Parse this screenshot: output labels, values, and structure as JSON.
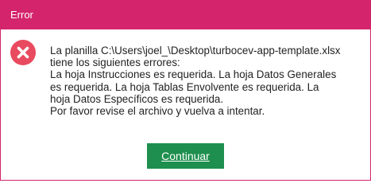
{
  "dialog": {
    "title": "Error",
    "icon": "error-x-circle-icon",
    "message_lines": [
      "La planilla C:\\Users\\joel_\\Desktop\\turbocev-app-template.xlsx",
      "tiene los siguientes errores:",
      "La hoja Instrucciones es requerida. La hoja Datos Generales",
      "es requerida. La hoja Tablas Envolvente es requerida. La",
      "hoja Datos Específicos es requerida.",
      "Por favor revise el archivo y vuelva a intentar."
    ],
    "continue_label": "Continuar"
  },
  "colors": {
    "titlebar": "#d4246c",
    "error_icon": "#e84a5f",
    "button": "#1e8f4e"
  }
}
